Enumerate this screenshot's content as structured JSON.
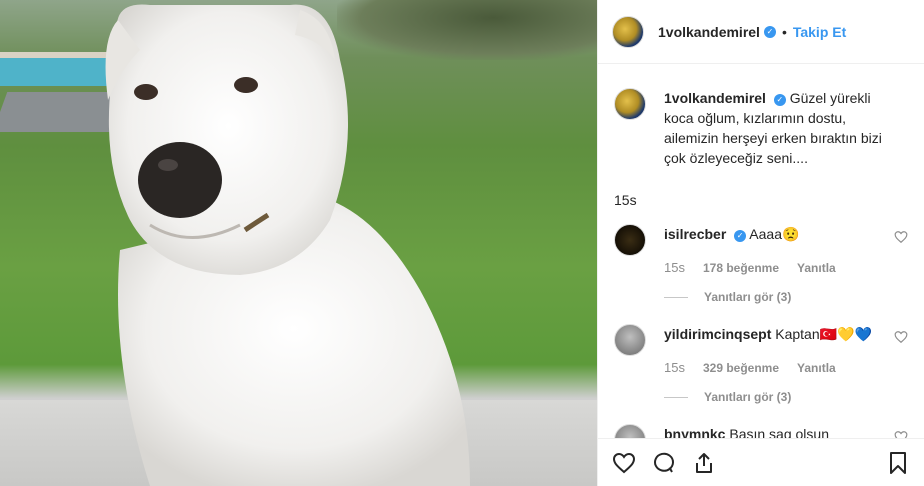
{
  "post": {
    "username": "1volkandemirel",
    "follow_label": "Takip Et",
    "caption": "Güzel yürekli koca oğlum, kızlarımın dostu, ailemizin herşeyi erken bıraktın bizi çok özleyeceğiz seni....",
    "caption_time": "15s"
  },
  "comments": [
    {
      "username": "isilrecber",
      "text": "Aaaa😟",
      "time": "15s",
      "likes": "178 beğenme",
      "reply_label": "Yanıtla",
      "view_replies": "Yanıtları gör (3)"
    },
    {
      "username": "yildirimcinqsept",
      "text": "Kaptan🇹🇷💛💙",
      "time": "15s",
      "likes": "329 beğenme",
      "reply_label": "Yanıtla",
      "view_replies": "Yanıtları gör (3)"
    },
    {
      "username": "bnymnkc",
      "text": "Basın sag olsun"
    }
  ],
  "icons": {
    "like": "heart-icon",
    "comment": "comment-icon",
    "share": "share-icon",
    "save": "bookmark-icon"
  },
  "colors": {
    "accent": "#3897f0",
    "muted": "#8e8e8e"
  }
}
